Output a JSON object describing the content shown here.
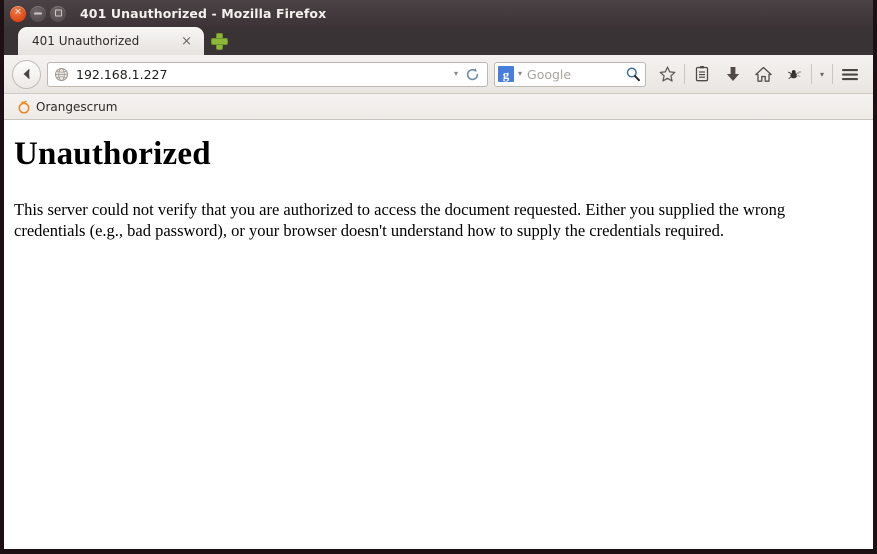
{
  "window": {
    "title": "401 Unauthorized - Mozilla Firefox",
    "controls": {
      "close": "close-button",
      "minimize": "minimize-button",
      "maximize": "maximize-button"
    }
  },
  "tabs": [
    {
      "label": "401 Unauthorized",
      "close_label": "×"
    }
  ],
  "newtab": {
    "label": "+"
  },
  "toolbar": {
    "back_label": "Back",
    "url": "192.168.1.227",
    "url_caret": "▾",
    "reload_label": "Reload",
    "search": {
      "engine_initial": "g",
      "engine_caret": "▾",
      "placeholder": "Google",
      "search_icon": "magnifier-icon"
    },
    "icons": [
      "bookmark-star-icon",
      "reader-list-icon",
      "downloads-icon",
      "home-icon",
      "firebug-icon",
      "menu-icon"
    ],
    "firebug_caret": "▾"
  },
  "bookmarks": [
    {
      "label": "Orangescrum",
      "icon": "orange-fruit-icon"
    }
  ],
  "page": {
    "heading": "Unauthorized",
    "body": "This server could not verify that you are authorized to access the document requested. Either you supplied the wrong credentials (e.g., bad password), or your browser doesn't understand how to supply the credentials required."
  },
  "colors": {
    "titlebar": "#3c3436",
    "close_button": "#dd4814",
    "newtab_plus": "#8cb739",
    "google_badge": "#4a7ddb",
    "bookmark_icon": "#f08a24",
    "page_background": "#ffffff"
  }
}
